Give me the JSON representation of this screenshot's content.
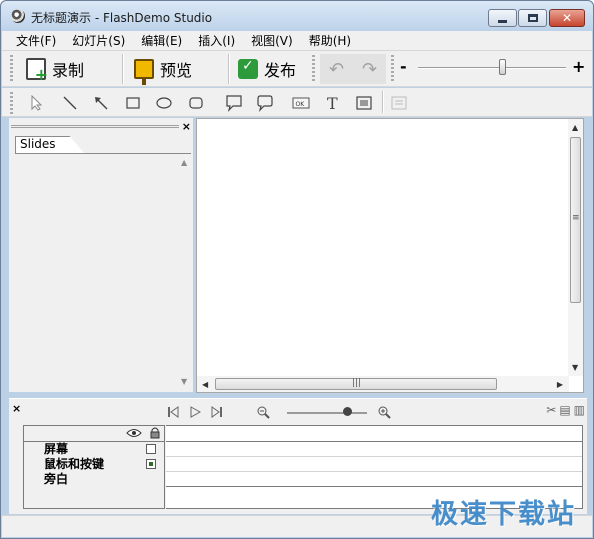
{
  "window": {
    "title": "无标题演示 - FlashDemo Studio"
  },
  "menu": {
    "items": [
      "文件(F)",
      "幻灯片(S)",
      "编辑(E)",
      "插入(I)",
      "视图(V)",
      "帮助(H)"
    ]
  },
  "toolbar": {
    "record_label": "录制",
    "preview_label": "预览",
    "publish_label": "发布",
    "zoom_minus": "-",
    "zoom_plus": "+",
    "zoom_level": 0.6
  },
  "draw_tools": [
    "select",
    "line",
    "arrow",
    "rectangle",
    "ellipse",
    "rounded-rect",
    "callout",
    "speech-bubble",
    "button",
    "text",
    "image",
    "caption"
  ],
  "slides_panel": {
    "close": "×",
    "tab_label": "Slides"
  },
  "timeline": {
    "close": "×",
    "layers": [
      {
        "label": "屏幕",
        "checked": false
      },
      {
        "label": "鼠标和按键",
        "checked": true
      },
      {
        "label": "旁白",
        "checked": null
      }
    ],
    "zoom_level": 0.78
  },
  "watermark": "极速下载站"
}
